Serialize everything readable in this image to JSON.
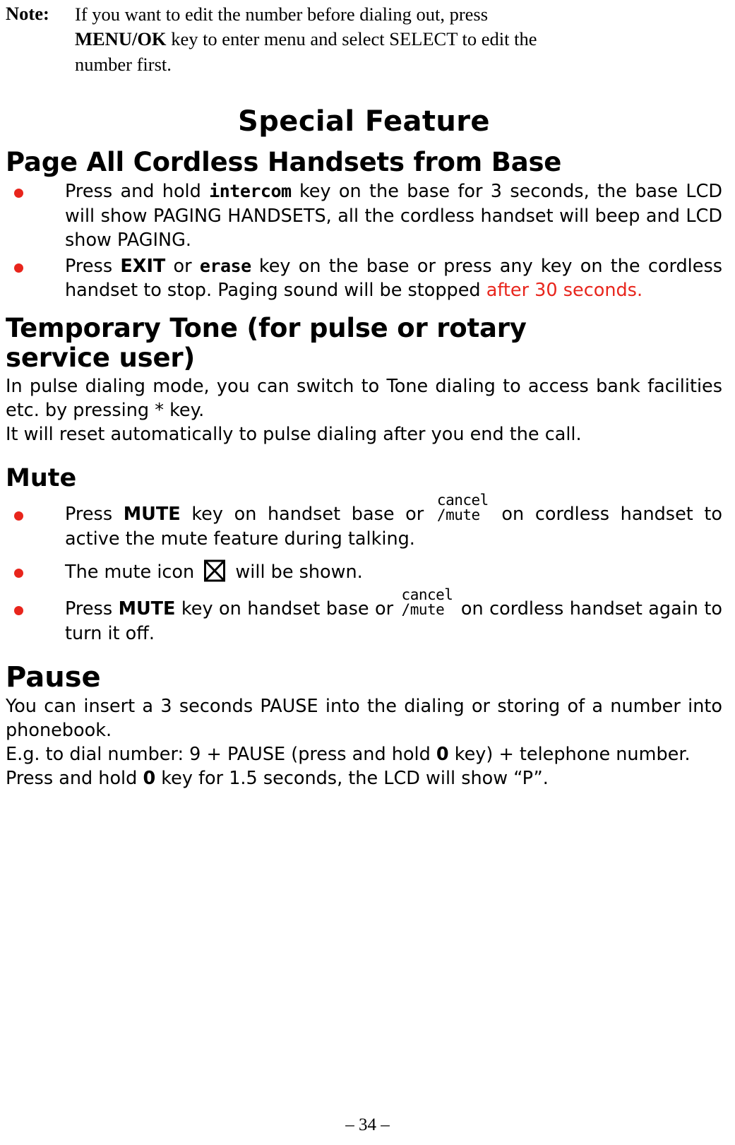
{
  "note": {
    "label": "Note:",
    "line1": "If you want to edit the number before dialing out, press",
    "line2_bold": "MENU/OK",
    "line2_rest": " key to enter menu and select SELECT to edit the",
    "line3": "number first."
  },
  "headings": {
    "special_feature": "Special Feature",
    "page_all": "Page All Cordless Handsets from Base",
    "temporary_tone_l1": "Temporary Tone (for pulse or rotary",
    "temporary_tone_l2": "service user)",
    "mute": "Mute",
    "pause": "Pause"
  },
  "page_all_bullets": [
    {
      "pre": "Press and hold ",
      "key": "intercom",
      "post": " key on the base for 3 seconds, the base LCD will show PAGING HANDSETS, all the cordless handset will beep and LCD show PAGING."
    },
    {
      "pre": "Press ",
      "key_bold": "EXIT",
      "mid": " or ",
      "key2": "erase",
      "post": " key on the base or press any key on the cordless handset to stop. Paging sound will be stopped ",
      "red": "after 30 seconds."
    }
  ],
  "temporary_tone": {
    "line1": "In pulse dialing mode, you can switch to Tone dialing to access bank facilities etc. by pressing * key.",
    "line2": "It will reset automatically to pulse dialing after you end the call."
  },
  "mute_bullets": [
    {
      "pre": "Press ",
      "key_bold": "MUTE",
      "mid": " key on handset base or ",
      "key_top": "cancel",
      "key_bot": "/mute",
      "post": " on cordless handset to active the mute feature during talking."
    },
    {
      "pre": "The mute icon ",
      "icon": "mute-icon",
      "post": " will be shown."
    },
    {
      "pre": "Press ",
      "key_bold": "MUTE",
      "mid": " key on handset base or ",
      "key_top": "cancel",
      "key_bot": "/mute",
      "post": " on cordless handset again to turn it off."
    }
  ],
  "pause": {
    "line1": "You can insert a 3 seconds PAUSE into the dialing or storing of a number into phonebook.",
    "line2_a": "E.g. to dial number: 9 + PAUSE (press and hold ",
    "line2_key": "0",
    "line2_b": " key) + telephone number.",
    "line3_a": "Press and hold ",
    "line3_key": "0",
    "line3_b": " key for 1.5 seconds, the LCD will show “P”."
  },
  "footer": {
    "page_number": "– 34 –"
  },
  "colors": {
    "bullet": "#e8251c",
    "accent_red": "#e8251c",
    "text": "#000000"
  }
}
